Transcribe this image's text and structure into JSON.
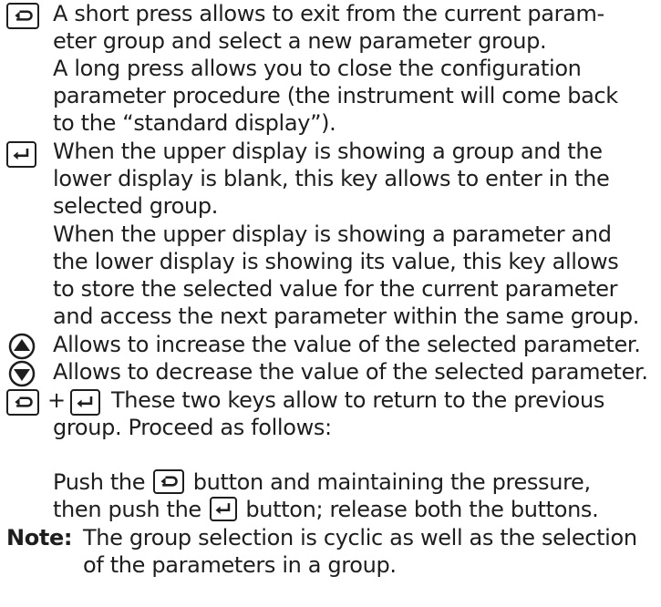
{
  "keys": {
    "exit_key_icon": "loop-arrow-icon",
    "enter_key_icon": "enter-return-icon",
    "up_key_icon": "up-arrow-icon",
    "down_key_icon": "down-arrow-icon"
  },
  "exit_key": {
    "lines": [
      "A short press allows to exit from the current param-",
      "eter group and select a new parameter group.",
      "A long press allows you to close the configuration",
      "parameter procedure (the instrument will come back",
      "to the “standard display”)."
    ]
  },
  "enter_key": {
    "lines": [
      "When the upper display is showing a group and the",
      "lower display is blank, this key allows to enter in the",
      "selected group.",
      "When the upper display is showing a parameter and",
      "the lower display is showing its value, this key allows",
      "to store the selected value for the current parameter",
      "and access the next parameter within the same group."
    ]
  },
  "up_key": {
    "text": "Allows to increase the value of the selected parameter."
  },
  "down_key": {
    "text": "Allows to decrease the value of the selected parameter."
  },
  "combo": {
    "plus": "+",
    "line1": "These two keys allow to return to the previous",
    "line2": "group.  Proceed as follows:",
    "line3": "Push the",
    "line3_after": "button and maintaining the pressure,",
    "line4": "then push the",
    "line4_after": "button; release both the buttons."
  },
  "note": {
    "label": "Note:",
    "line1": "The group selection is cyclic as well as the selection",
    "line2": "of the parameters in a group."
  }
}
